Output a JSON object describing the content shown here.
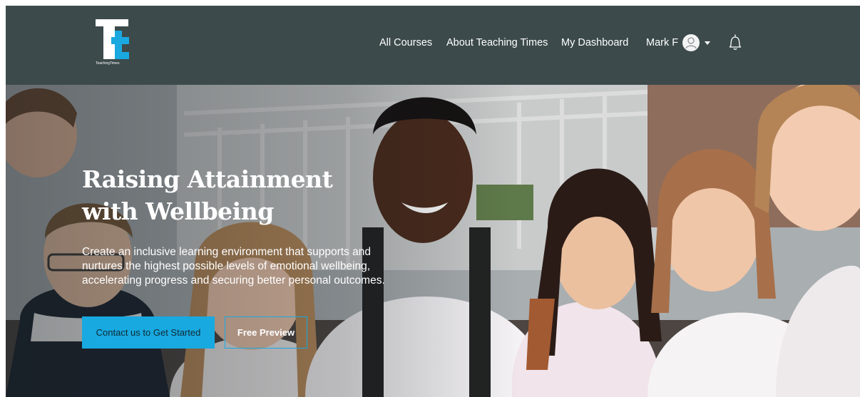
{
  "brand": {
    "logo_subtext": "TeachingTimes",
    "accent_color": "#18a9e1",
    "header_bg": "#3c4a4b"
  },
  "nav": {
    "items": [
      {
        "label": "All Courses"
      },
      {
        "label": "About Teaching Times"
      },
      {
        "label": "My Dashboard"
      }
    ],
    "user_name": "Mark F",
    "avatar_icon": "user-avatar-icon",
    "caret_icon": "caret-down-icon",
    "bell_icon": "bell-icon"
  },
  "hero": {
    "title": "Raising Attainment with Wellbeing",
    "description": "Create an inclusive learning environment that supports and nurtures the highest possible levels of emotional wellbeing, accelerating progress and securing better personal outcomes.",
    "primary_cta": "Contact us to Get Started",
    "secondary_cta": "Free Preview"
  }
}
